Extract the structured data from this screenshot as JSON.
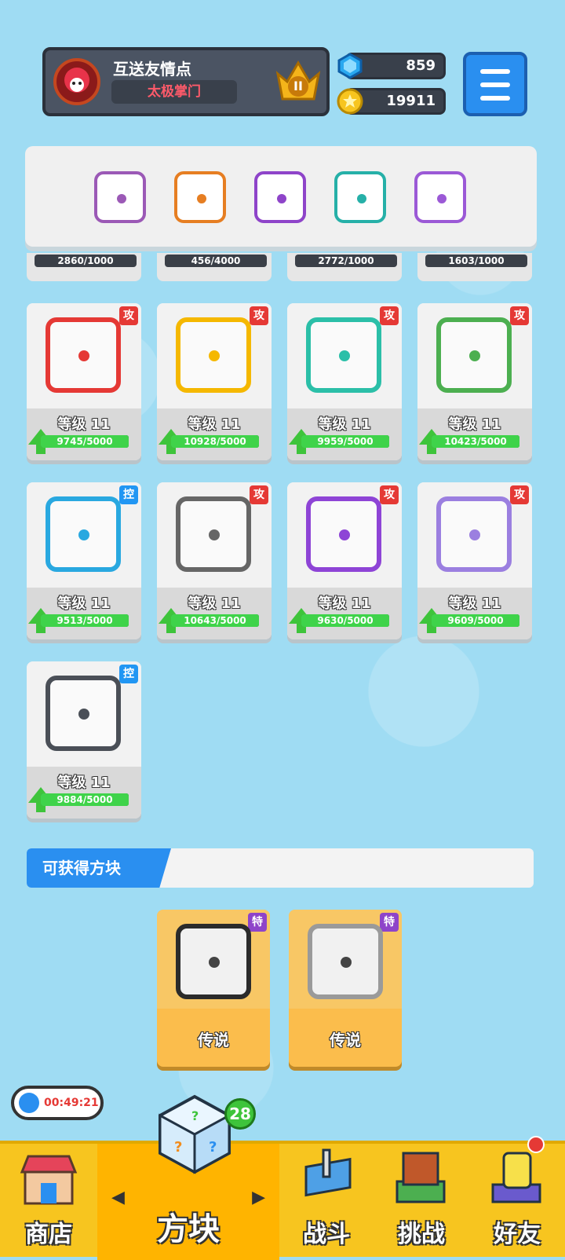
{
  "header": {
    "player_name": "互送友情点",
    "player_title": "太极掌门",
    "rank_label": "II",
    "gems": "859",
    "coins": "19911"
  },
  "deck": [
    {
      "icon": "saw-blade-icon",
      "color": "#9b59b6"
    },
    {
      "icon": "infinity-icon",
      "color": "#e67e22"
    },
    {
      "icon": "spiral-icon",
      "color": "#8e44c9"
    },
    {
      "icon": "hands-icon",
      "color": "#26b0a8"
    },
    {
      "icon": "cracked-icon",
      "color": "#9b59d6"
    }
  ],
  "partial_row": [
    {
      "progress": "2860/1000"
    },
    {
      "progress": "456/4000"
    },
    {
      "progress": "2772/1000"
    },
    {
      "progress": "1603/1000"
    }
  ],
  "cards": [
    {
      "tag": "攻",
      "type": "atk",
      "level": "等级 11",
      "progress": "9745/5000",
      "fill": 1.0,
      "color": "#e53935",
      "icon": "fire-dice-icon"
    },
    {
      "tag": "攻",
      "type": "atk",
      "level": "等级 11",
      "progress": "10928/5000",
      "fill": 1.0,
      "color": "#f5b800",
      "icon": "electric-dice-icon"
    },
    {
      "tag": "攻",
      "type": "atk",
      "level": "等级 11",
      "progress": "9959/5000",
      "fill": 1.0,
      "color": "#2bbfa8",
      "icon": "wind-dice-icon"
    },
    {
      "tag": "攻",
      "type": "atk",
      "level": "等级 11",
      "progress": "10423/5000",
      "fill": 1.0,
      "color": "#4caf50",
      "icon": "poison-dice-icon"
    },
    {
      "tag": "控",
      "type": "ctl",
      "level": "等级 11",
      "progress": "9513/5000",
      "fill": 1.0,
      "color": "#29a8e0",
      "icon": "ice-dice-icon"
    },
    {
      "tag": "攻",
      "type": "atk",
      "level": "等级 11",
      "progress": "10643/5000",
      "fill": 1.0,
      "color": "#666666",
      "icon": "gear-dice-icon"
    },
    {
      "tag": "攻",
      "type": "atk",
      "level": "等级 11",
      "progress": "9630/5000",
      "fill": 1.0,
      "color": "#8e44d6",
      "icon": "arrows-dice-icon"
    },
    {
      "tag": "攻",
      "type": "atk",
      "level": "等级 11",
      "progress": "9609/5000",
      "fill": 1.0,
      "color": "#9b7fe0",
      "icon": "mystery-dice-icon"
    },
    {
      "tag": "控",
      "type": "ctl",
      "level": "等级 11",
      "progress": "9884/5000",
      "fill": 1.0,
      "color": "#4a4f57",
      "icon": "lock-dice-icon"
    }
  ],
  "available": {
    "title": "可获得方块",
    "items": [
      {
        "tag": "特",
        "rarity": "传说",
        "icon": "legendary-flame-dice-icon"
      },
      {
        "tag": "特",
        "rarity": "传说",
        "icon": "legendary-sun-dice-icon"
      }
    ]
  },
  "timer": "00:49:21",
  "dice_badge": "28",
  "nav": [
    {
      "label": "商店",
      "icon": "shop-icon"
    },
    {
      "label": "方块",
      "icon": "dice-box-icon"
    },
    {
      "label": "战斗",
      "icon": "battle-icon"
    },
    {
      "label": "挑战",
      "icon": "challenge-icon"
    },
    {
      "label": "好友",
      "icon": "friends-icon"
    }
  ]
}
